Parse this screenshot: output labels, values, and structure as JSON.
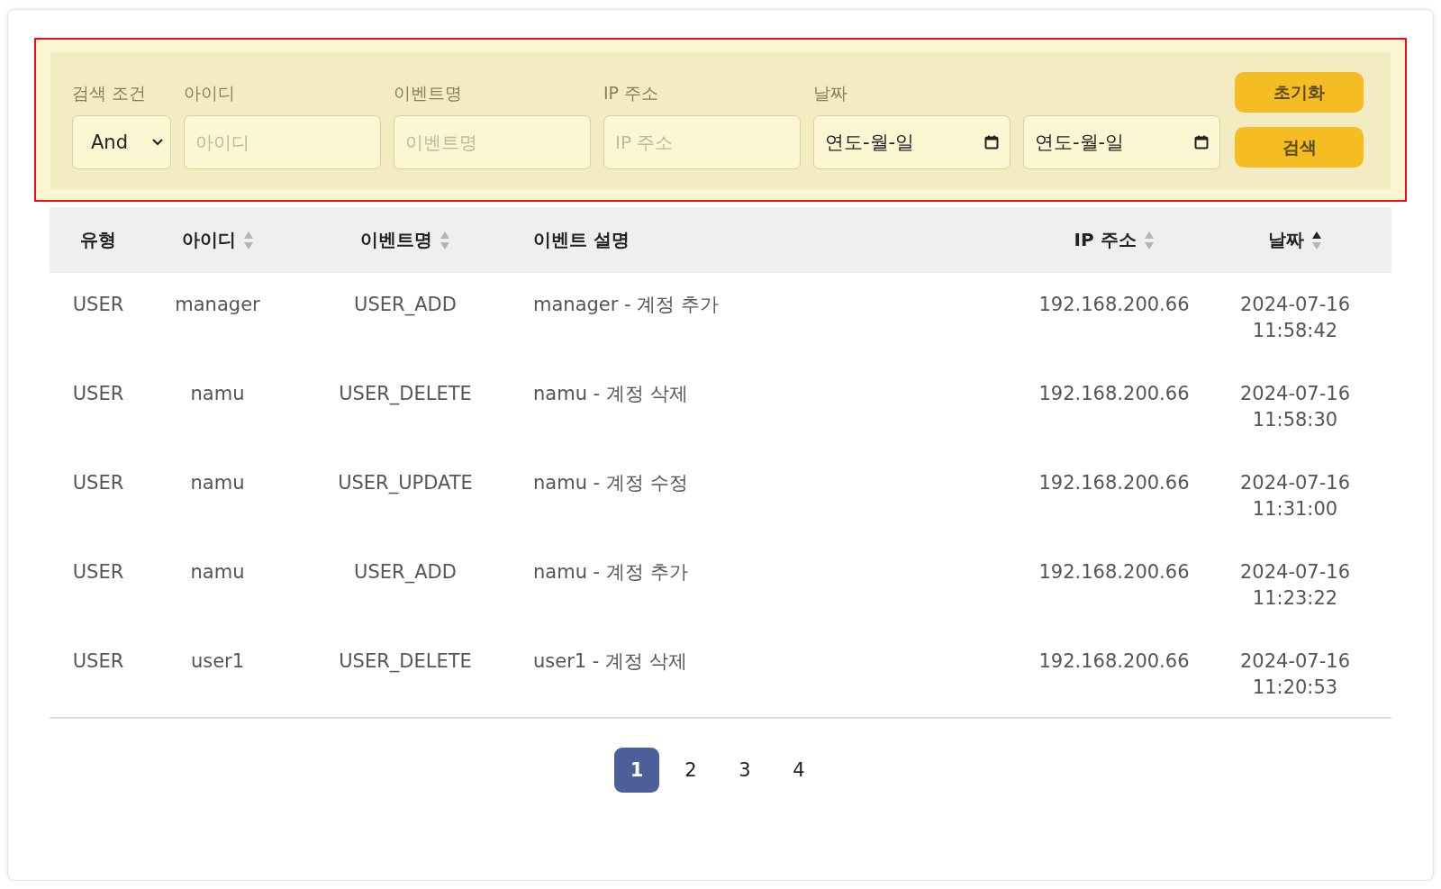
{
  "filters": {
    "condition": {
      "label": "검색 조건",
      "value": "And"
    },
    "fields": [
      {
        "kind": "text",
        "label": "아이디",
        "placeholder": "아이디"
      },
      {
        "kind": "text",
        "label": "이벤트명",
        "placeholder": "이벤트명"
      },
      {
        "kind": "text",
        "label": "IP 주소",
        "placeholder": "IP 주소"
      },
      {
        "kind": "date",
        "label": "날짜",
        "value": "연도-월-일"
      },
      {
        "kind": "date",
        "value": "연도-월-일"
      }
    ],
    "buttons": [
      "초기화",
      "검색"
    ]
  },
  "table": {
    "columns": [
      {
        "label": "유형"
      },
      {
        "label": "아이디",
        "sortable": true,
        "sorted_ascending": false
      },
      {
        "label": "이벤트명",
        "sortable": true,
        "sorted_ascending": false
      },
      {
        "label": "이벤트 설명"
      },
      {
        "label": "IP 주소",
        "sortable": true,
        "sorted_ascending": false
      },
      {
        "label": "날짜",
        "sortable": true,
        "sorted_ascending": true
      }
    ],
    "rows": [
      [
        "USER",
        "manager",
        "USER_ADD",
        "manager - 계정 추가",
        "192.168.200.66",
        [
          "2024-07-16",
          "11:58:42"
        ]
      ],
      [
        "USER",
        "namu",
        "USER_DELETE",
        "namu - 계정 삭제",
        "192.168.200.66",
        [
          "2024-07-16",
          "11:58:30"
        ]
      ],
      [
        "USER",
        "namu",
        "USER_UPDATE",
        "namu - 계정 수정",
        "192.168.200.66",
        [
          "2024-07-16",
          "11:31:00"
        ]
      ],
      [
        "USER",
        "namu",
        "USER_ADD",
        "namu - 계정 추가",
        "192.168.200.66",
        [
          "2024-07-16",
          "11:23:22"
        ]
      ],
      [
        "USER",
        "user1",
        "USER_DELETE",
        "user1 - 계정 삭제",
        "192.168.200.66",
        [
          "2024-07-16",
          "11:20:53"
        ]
      ]
    ]
  },
  "pagination": [
    {
      "label": "1",
      "selected": true
    },
    {
      "label": "2",
      "selected": false
    },
    {
      "label": "3",
      "selected": false
    },
    {
      "label": "4",
      "selected": false
    }
  ]
}
